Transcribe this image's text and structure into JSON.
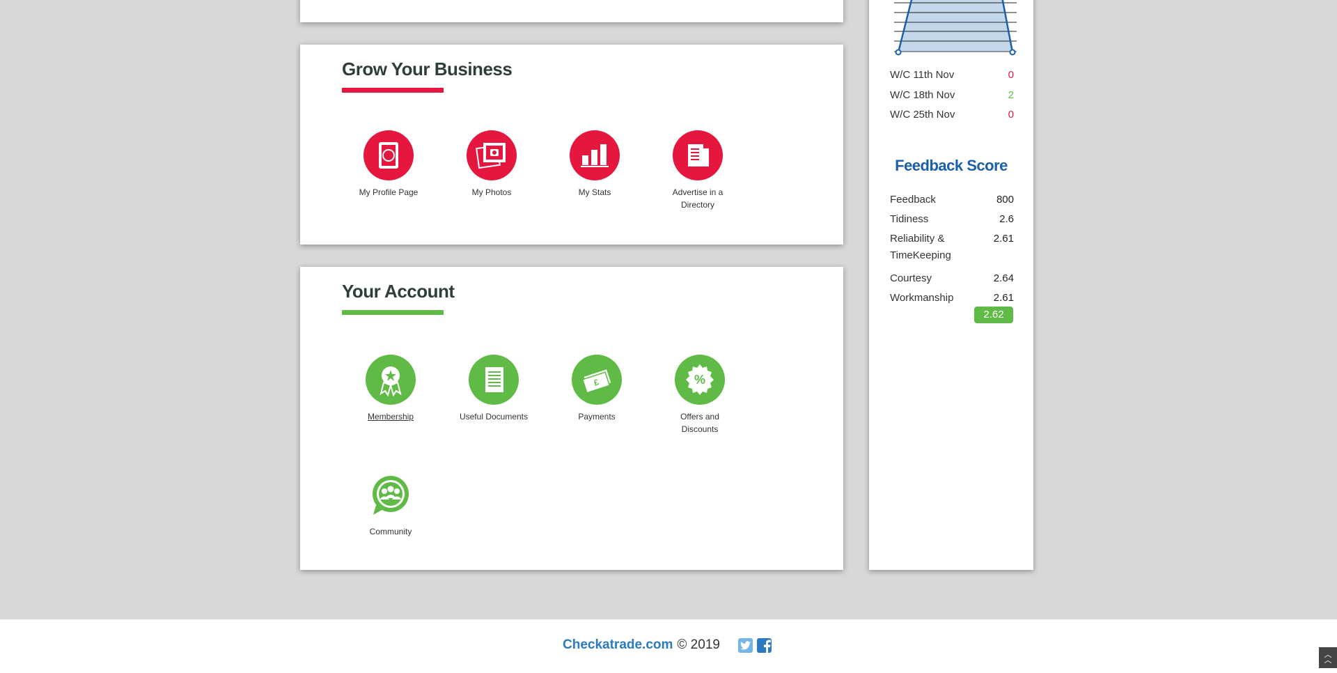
{
  "grow": {
    "title": "Grow Your Business",
    "accent": "#e5173f",
    "tiles": [
      {
        "label": "My Profile Page",
        "icon": "profile-page-icon"
      },
      {
        "label": "My Photos",
        "icon": "photos-icon"
      },
      {
        "label": "My Stats",
        "icon": "stats-icon"
      },
      {
        "label": "Advertise in a Directory",
        "icon": "directory-icon"
      }
    ]
  },
  "account": {
    "title": "Your Account",
    "accent": "#5fbb46",
    "tiles": [
      {
        "label": "Membership",
        "icon": "membership-icon"
      },
      {
        "label": "Useful Documents",
        "icon": "documents-icon"
      },
      {
        "label": "Payments",
        "icon": "payments-icon"
      },
      {
        "label": "Offers and Discounts",
        "icon": "offers-icon"
      },
      {
        "label": "Community",
        "icon": "community-icon"
      }
    ]
  },
  "sidebar": {
    "weeks": [
      {
        "label": "W/C 11th Nov",
        "value": "0",
        "color": "#e5173f"
      },
      {
        "label": "W/C 18th Nov",
        "value": "2",
        "color": "#5fbb46"
      },
      {
        "label": "W/C 25th Nov",
        "value": "0",
        "color": "#e5173f"
      }
    ],
    "feedback_title": "Feedback Score",
    "scores": [
      {
        "label": "Feedback",
        "value": "800"
      },
      {
        "label": "Tidiness",
        "value": "2.6"
      },
      {
        "label": "Reliability & TimeKeeping",
        "value": "2.61"
      },
      {
        "label": "Courtesy",
        "value": "2.64"
      },
      {
        "label": "Workmanship",
        "value": "2.61"
      }
    ],
    "overall": "2.62"
  },
  "footer": {
    "brand": "Checkatrade.com",
    "copyright": "© 2019",
    "social": [
      "twitter-icon",
      "facebook-icon"
    ]
  }
}
